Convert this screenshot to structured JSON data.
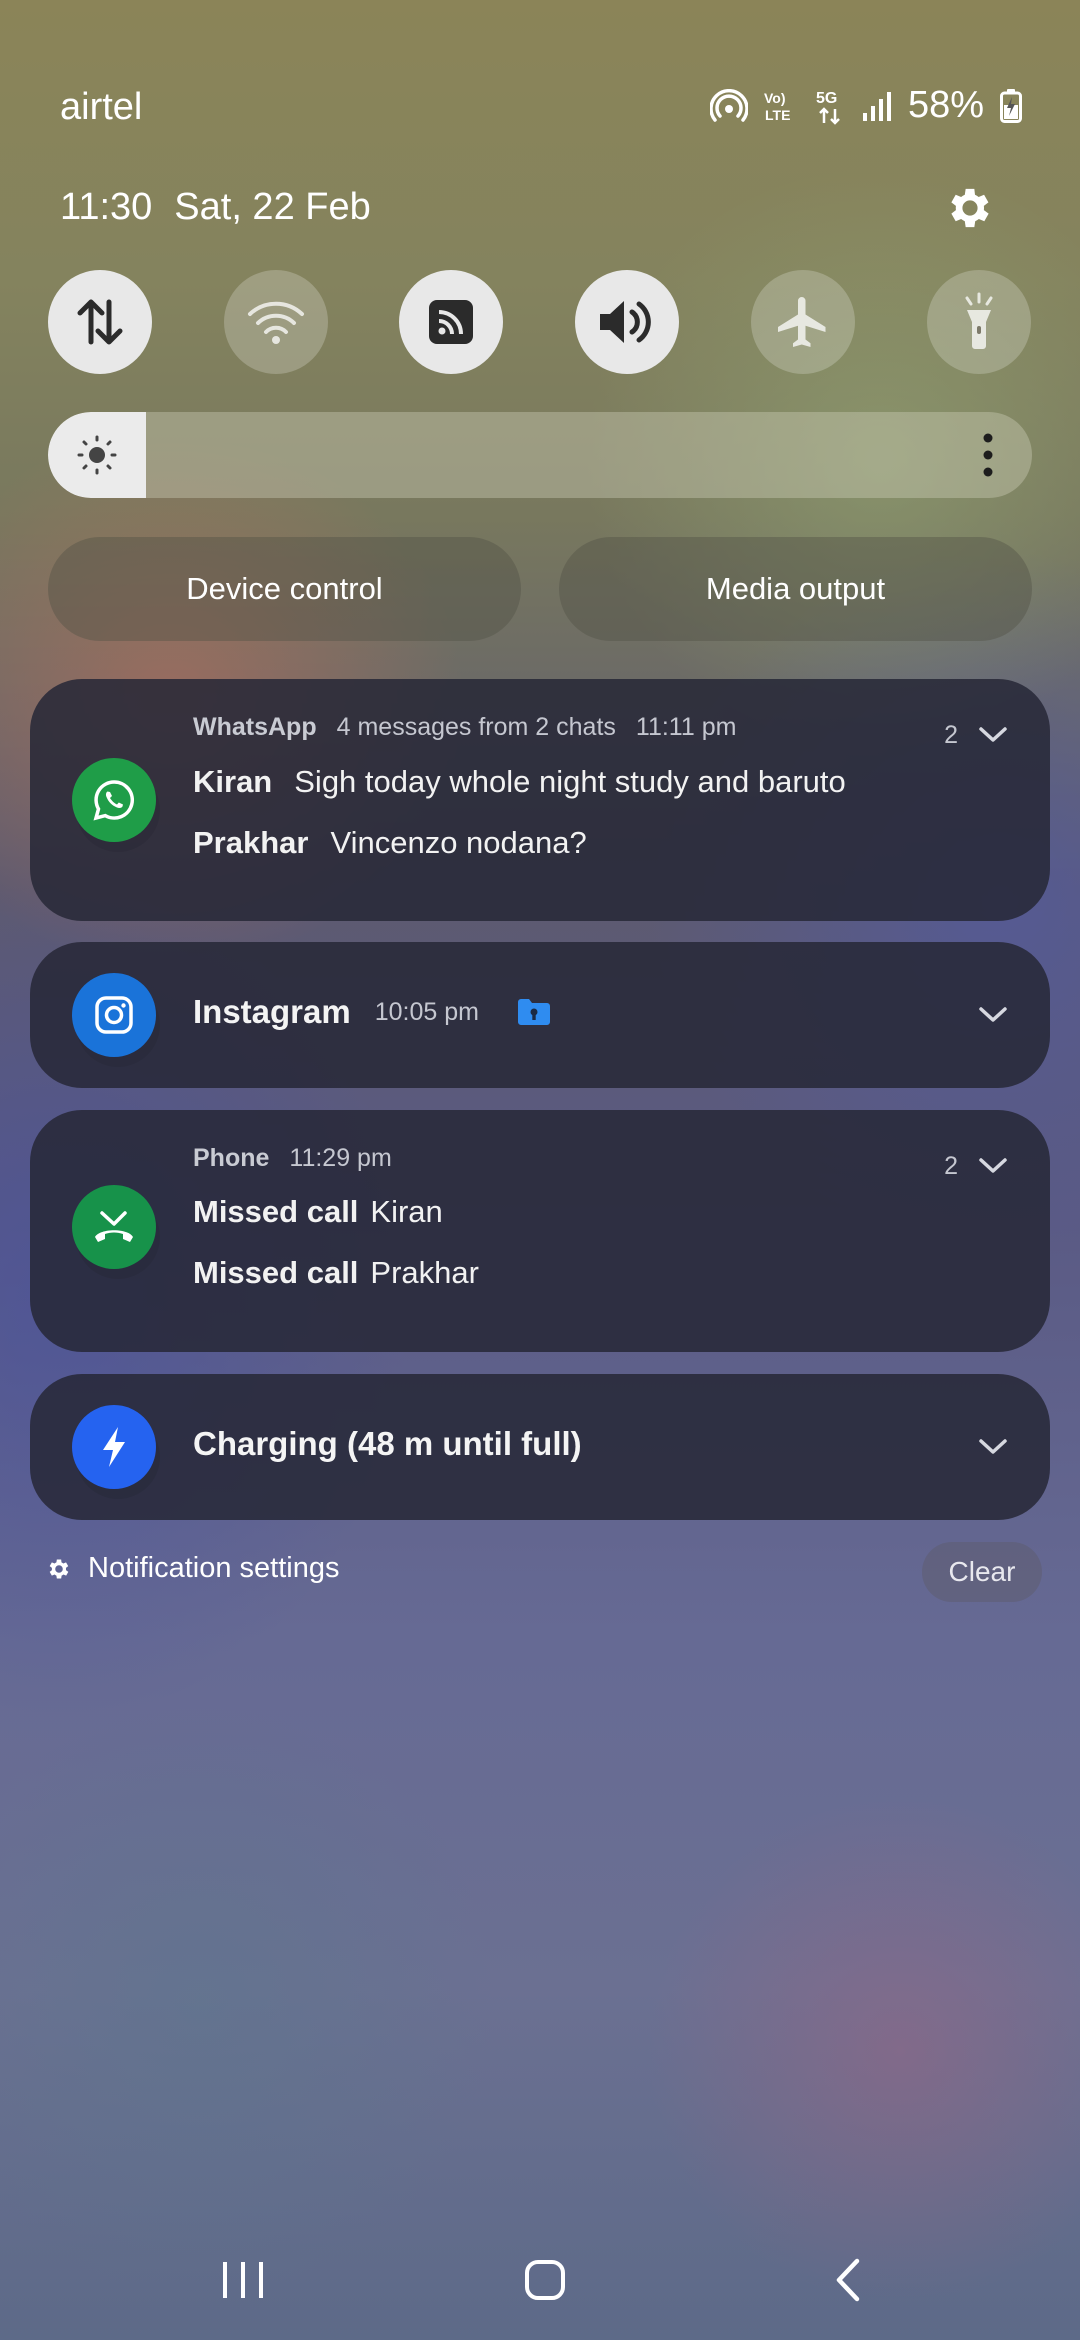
{
  "status_bar": {
    "carrier": "airtel",
    "network_labels": {
      "volte_top": "Vo)",
      "volte_bottom": "LTE",
      "fiveg": "5G"
    },
    "battery_percent": "58%"
  },
  "header": {
    "time": "11:30",
    "date": "Sat, 22 Feb"
  },
  "quick_toggles": [
    {
      "name": "mobile-data",
      "state": "on"
    },
    {
      "name": "wifi",
      "state": "off"
    },
    {
      "name": "nfc",
      "state": "on"
    },
    {
      "name": "sound",
      "state": "on"
    },
    {
      "name": "airplane-mode",
      "state": "off"
    },
    {
      "name": "flashlight",
      "state": "off"
    }
  ],
  "brightness": {
    "level_fraction": 0.1
  },
  "panel_buttons": {
    "device_control": "Device control",
    "media_output": "Media output"
  },
  "notifications": {
    "whatsapp": {
      "app": "WhatsApp",
      "summary": "4 messages from 2 chats",
      "time": "11:11 pm",
      "count": "2",
      "messages": [
        {
          "sender": "Kiran",
          "text": "Sigh today whole night study and baruto"
        },
        {
          "sender": "Prakhar",
          "text": "Vincenzo nodana?"
        }
      ]
    },
    "instagram": {
      "app": "Instagram",
      "time": "10:05 pm"
    },
    "phone": {
      "app": "Phone",
      "time": "11:29 pm",
      "count": "2",
      "calls": [
        {
          "label": "Missed call",
          "name": "Kiran"
        },
        {
          "label": "Missed call",
          "name": "Prakhar"
        }
      ]
    },
    "charging": {
      "title": "Charging (48 m until full)"
    }
  },
  "footer": {
    "notification_settings": "Notification settings",
    "clear": "Clear"
  },
  "colors": {
    "whatsapp_green": "#1f9d48",
    "instagram_blue": "#1a73d9",
    "phone_green": "#17924a",
    "charging_blue": "#2563f0"
  }
}
